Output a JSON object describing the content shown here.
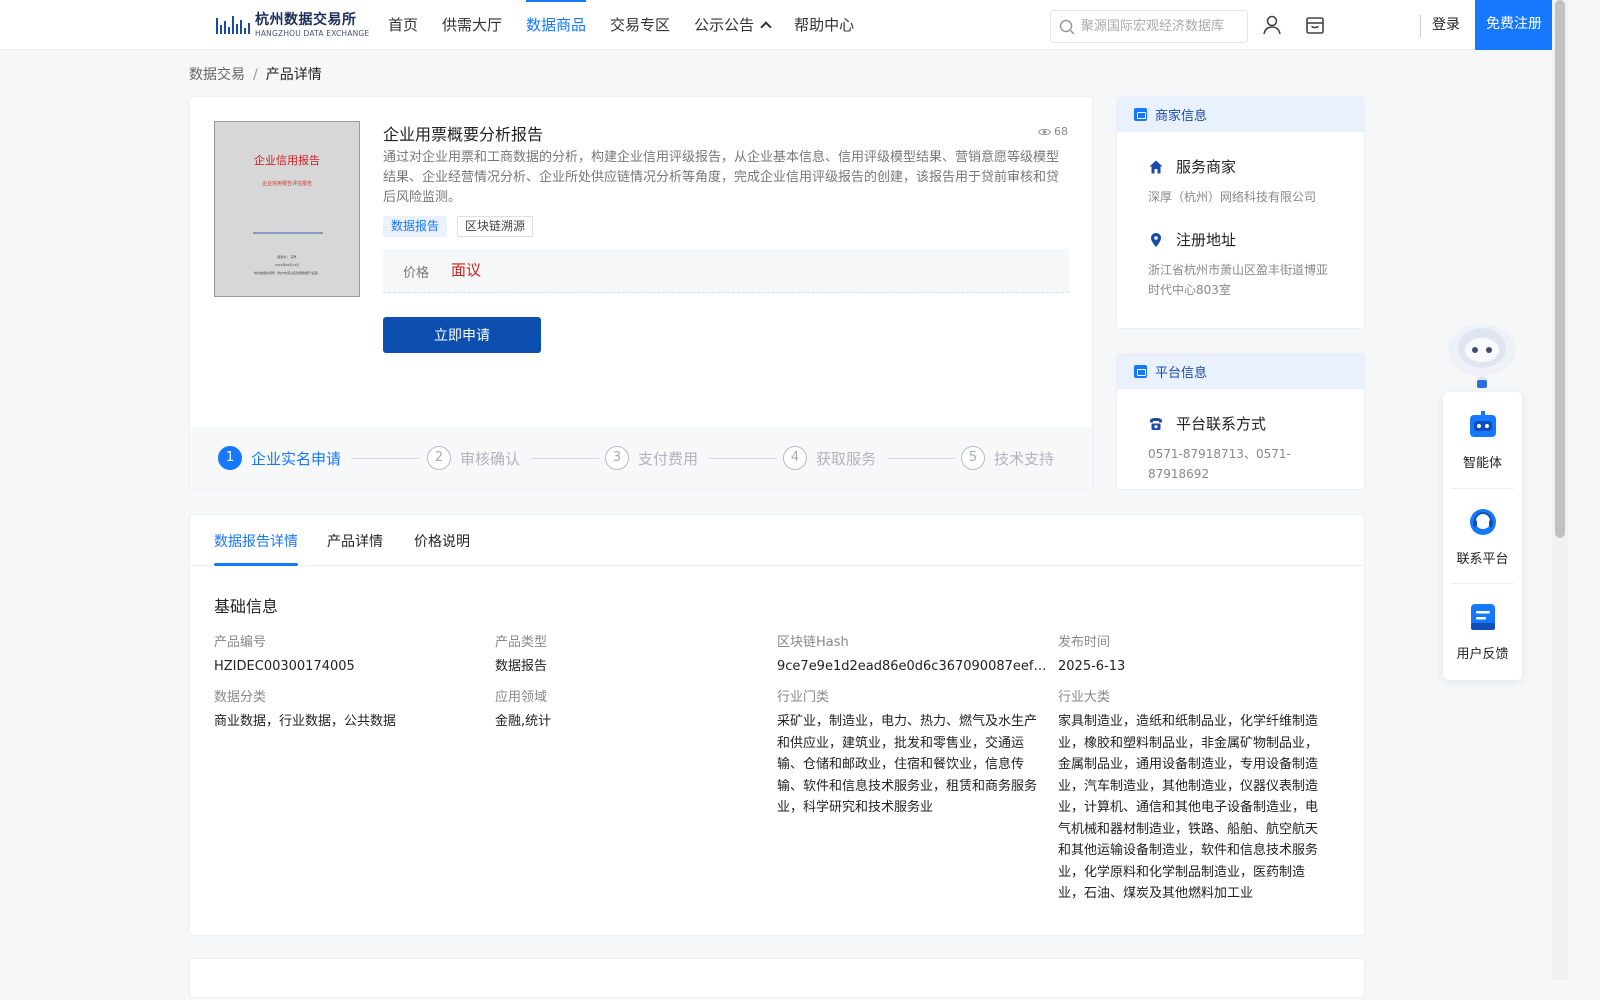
{
  "header": {
    "logo_cn": "杭州数据交易所",
    "logo_en": "HANGZHOU DATA EXCHANGE",
    "nav": [
      "首页",
      "供需大厅",
      "数据商品",
      "交易专区",
      "公示公告",
      "帮助中心"
    ],
    "search_placeholder": "聚源国际宏观经济数据库",
    "login": "登录",
    "register": "免费注册"
  },
  "breadcrumb": {
    "parent": "数据交易",
    "separator": "/",
    "current": "产品详情"
  },
  "product": {
    "title": "企业用票概要分析报告",
    "views": "68",
    "description": "通过对企业用票和工商数据的分析，构建企业信用评级报告，从企业基本信息、信用评级模型结果、营销意愿等级模型结果、企业经营情况分析、企业所处供应链情况分析等角度，完成企业信用评级报告的创建，该报告用于贷前审核和贷后风险监测。",
    "tags": [
      "数据报告",
      "区块链溯源"
    ],
    "price_label": "价格",
    "price_value": "面议",
    "apply_button": "立即申请",
    "cover": {
      "title": "企业信用报告",
      "subtitle": "企业信用报告评估报告",
      "footer_1": "服务商： 深厚",
      "footer_2": "2024年06月13日",
      "footer_3": "杭州数据交易所（杭州市萧山区钱塘数据产业园）"
    },
    "steps": [
      {
        "num": "1",
        "label": "企业实名申请"
      },
      {
        "num": "2",
        "label": "审核确认"
      },
      {
        "num": "3",
        "label": "支付费用"
      },
      {
        "num": "4",
        "label": "获取服务"
      },
      {
        "num": "5",
        "label": "技术支持"
      }
    ]
  },
  "merchant": {
    "header": "商家信息",
    "service_title": "服务商家",
    "service_value": "深厚（杭州）网络科技有限公司",
    "address_title": "注册地址",
    "address_value": "浙江省杭州市萧山区盈丰街道博亚时代中心803室"
  },
  "platform": {
    "header": "平台信息",
    "contact_title": "平台联系方式",
    "contact_value": "0571-87918713、0571-87918692"
  },
  "detail": {
    "tabs": [
      "数据报告详情",
      "产品详情",
      "价格说明"
    ],
    "section_title": "基础信息",
    "fields": [
      {
        "label": "产品编号",
        "value": "HZIDEC00300174005"
      },
      {
        "label": "产品类型",
        "value": "数据报告"
      },
      {
        "label": "区块链Hash",
        "value": "9ce7e9e1d2ead86e0d6c367090087eefa7..."
      },
      {
        "label": "发布时间",
        "value": "2025-6-13"
      },
      {
        "label": "数据分类",
        "value": "商业数据，行业数据，公共数据"
      },
      {
        "label": "应用领域",
        "value": "金融,统计"
      },
      {
        "label": "行业门类",
        "value": "采矿业，制造业，电力、热力、燃气及水生产和供应业，建筑业，批发和零售业，交通运输、仓储和邮政业，住宿和餐饮业，信息传输、软件和信息技术服务业，租赁和商务服务业，科学研究和技术服务业"
      },
      {
        "label": "行业大类",
        "value": "家具制造业，造纸和纸制品业，化学纤维制造业，橡胶和塑料制品业，非金属矿物制品业，金属制品业，通用设备制造业，专用设备制造业，汽车制造业，其他制造业，仪器仪表制造业，计算机、通信和其他电子设备制造业，电气机械和器材制造业，铁路、船舶、航空航天和其他运输设备制造业，软件和信息技术服务业，化学原料和化学制品制造业，医药制造业，石油、煤炭及其他燃料加工业"
      }
    ]
  },
  "float_widget": {
    "items": [
      "智能体",
      "联系平台",
      "用户反馈"
    ]
  },
  "colors": {
    "primary": "#1677ff",
    "apply_button": "#0d4fb0",
    "price": "#d0211c"
  }
}
